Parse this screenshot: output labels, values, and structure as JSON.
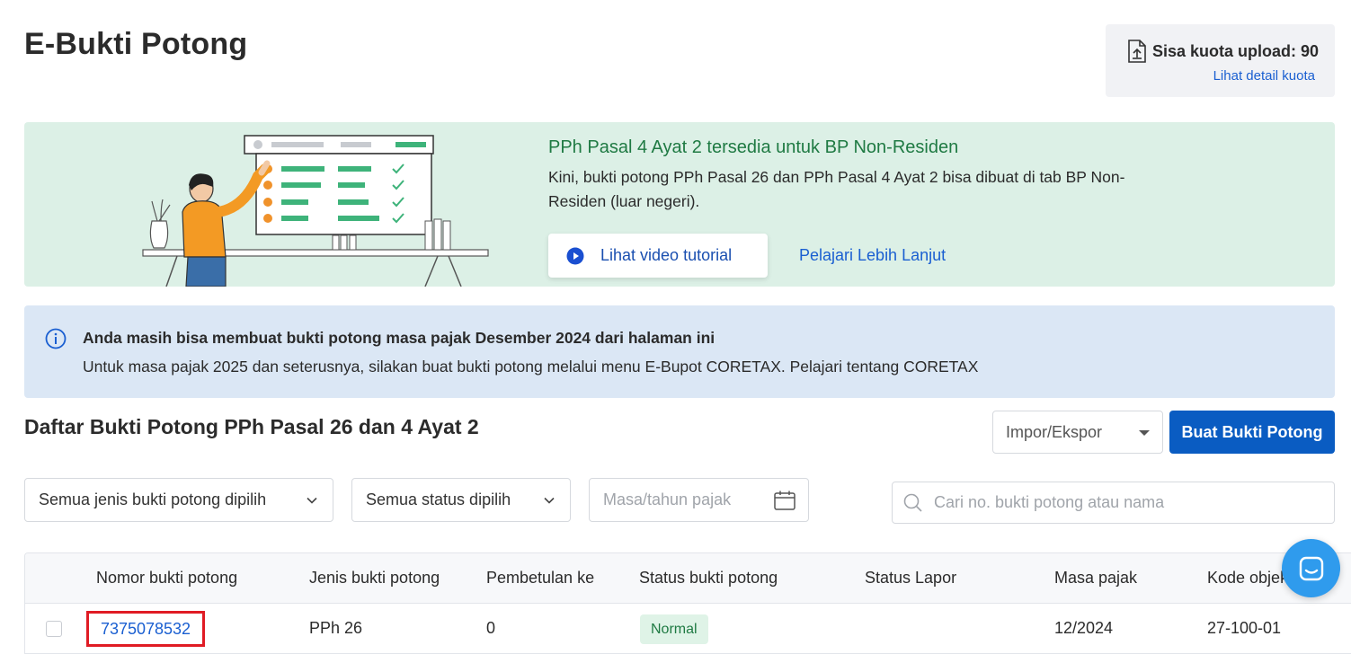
{
  "page": {
    "title": "E-Bukti Potong"
  },
  "quota": {
    "label": "Sisa kuota upload: 90",
    "detail_link": "Lihat detail kuota",
    "icon": "upload-file-icon"
  },
  "promo": {
    "title": "PPh Pasal 4 Ayat 2 tersedia untuk BP Non-Residen",
    "description": "Kini, bukti potong PPh Pasal 26 dan PPh Pasal 4 Ayat 2 bisa dibuat di tab BP Non-Residen (luar negeri).",
    "video_button": "Lihat video tutorial",
    "learn_more": "Pelajari Lebih Lanjut",
    "title_color": "#1f7a43",
    "background": "#dcf0e6"
  },
  "info": {
    "title": "Anda masih bisa membuat bukti potong masa pajak Desember 2024 dari halaman ini",
    "description": "Untuk masa pajak 2025 dan seterusnya, silakan buat bukti potong melalui menu E-Bupot CORETAX. Pelajari tentang CORETAX",
    "icon": "info-icon"
  },
  "list": {
    "title": "Daftar Bukti Potong PPh Pasal 26 dan 4 Ayat 2",
    "import_export": "Impor/Ekspor",
    "create_button": "Buat Bukti Potong",
    "primary_color": "#0a5cc2"
  },
  "filters": {
    "type": "Semua jenis bukti potong dipilih",
    "status": "Semua status dipilih",
    "period_placeholder": "Masa/tahun pajak",
    "search_placeholder": "Cari no. bukti potong atau nama"
  },
  "table": {
    "headers": [
      "Nomor bukti potong",
      "Jenis bukti potong",
      "Pembetulan ke",
      "Status bukti potong",
      "Status Lapor",
      "Masa pajak",
      "Kode objek"
    ],
    "rows": [
      {
        "nomor": "7375078532",
        "jenis": "PPh 26",
        "pembetulan": "0",
        "status": "Normal",
        "status_lapor": "",
        "masa": "12/2024",
        "kode": "27-100-01"
      }
    ]
  }
}
